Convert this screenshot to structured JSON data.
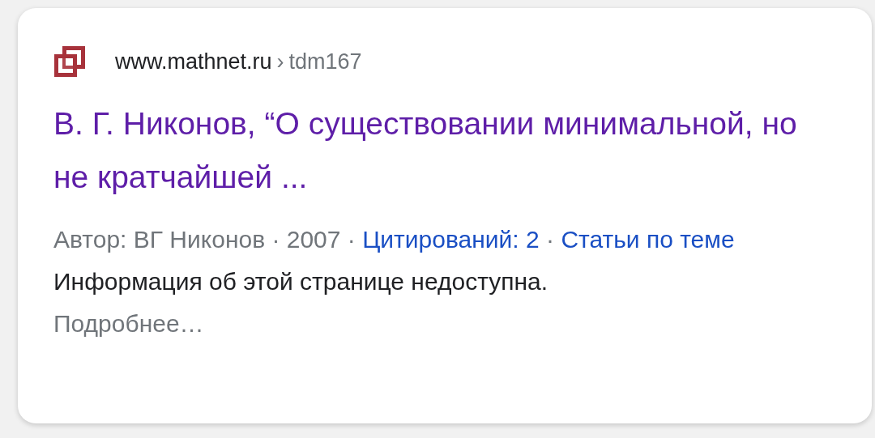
{
  "result": {
    "domain": "www.mathnet.ru",
    "breadcrumb_separator": "›",
    "path": "tdm167",
    "title": "В. Г. Никонов, “О существовании минимальной, но не кратчайшей ...",
    "meta": [
      {
        "kind": "text",
        "text": "Автор: ВГ Никонов · 2007 ·"
      },
      {
        "kind": "link",
        "text": "Цитирований: 2"
      },
      {
        "kind": "text",
        "text": "·"
      },
      {
        "kind": "link",
        "text": "Статьи по теме"
      }
    ],
    "snippet": "Информация об этой странице недоступна.",
    "more": "Подробнее…"
  }
}
